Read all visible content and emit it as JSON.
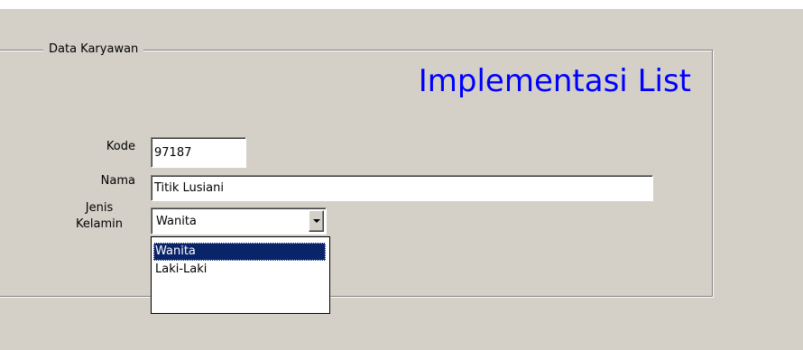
{
  "group": {
    "legend": "Data Karyawan"
  },
  "form": {
    "title": "Implementasi List",
    "kode": {
      "label": "Kode",
      "value": "97187"
    },
    "nama": {
      "label": "Nama",
      "value": "Titik Lusiani"
    },
    "jenis_kelamin": {
      "label": "Jenis Kelamin",
      "selected": "Wanita",
      "options": [
        "Wanita",
        "Laki-Laki"
      ],
      "dropdown_icon": "chevron-down-icon"
    }
  },
  "colors": {
    "window_bg": "#d4d0c8",
    "title_color": "#0000ff",
    "selection_bg": "#0a246a"
  }
}
